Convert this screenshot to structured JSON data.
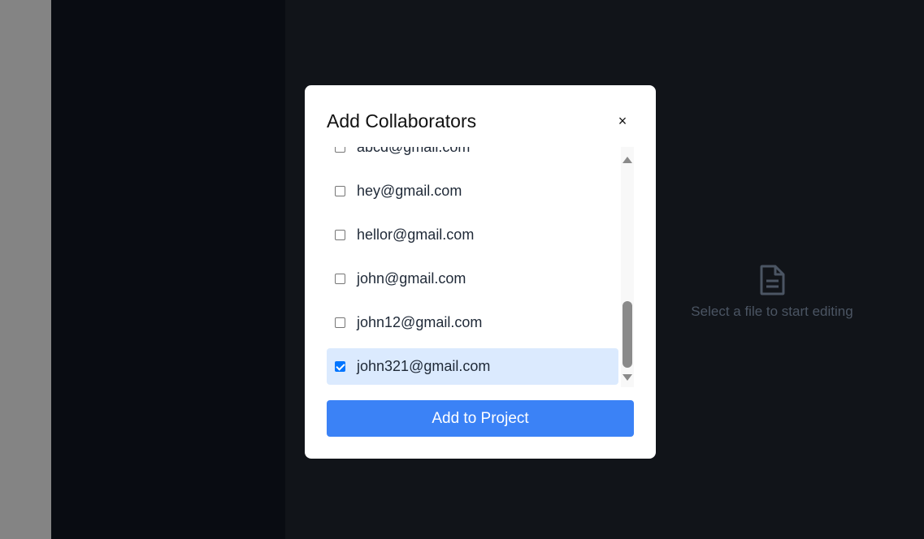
{
  "empty_state": {
    "icon": "file-text-icon",
    "message": "Select a file to start editing"
  },
  "modal": {
    "title": "Add Collaborators",
    "close_label": "×",
    "collaborators": [
      {
        "email": "abcd@gmail.com",
        "checked": false
      },
      {
        "email": "hey@gmail.com",
        "checked": false
      },
      {
        "email": "hellor@gmail.com",
        "checked": false
      },
      {
        "email": "john@gmail.com",
        "checked": false
      },
      {
        "email": "john12@gmail.com",
        "checked": false
      },
      {
        "email": "john321@gmail.com",
        "checked": true
      }
    ],
    "submit_label": "Add to Project"
  },
  "colors": {
    "accent": "#3b82f6",
    "selected_row": "#dbeafe",
    "backdrop_main": "#111419",
    "backdrop_sidebar": "#090c12"
  }
}
